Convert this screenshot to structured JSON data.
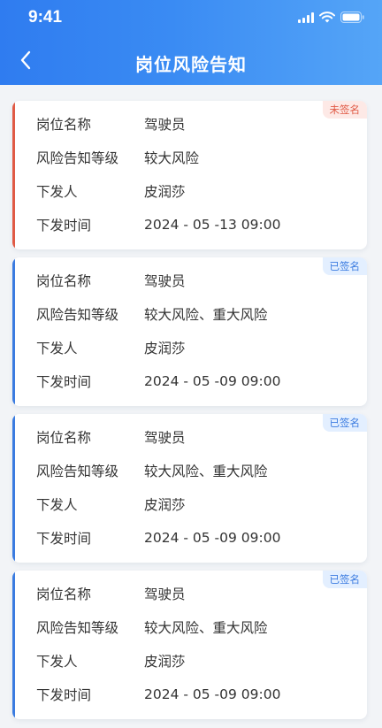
{
  "status_bar": {
    "time": "9:41"
  },
  "header": {
    "title": "岗位风险告知"
  },
  "labels": {
    "position_name": "岗位名称",
    "risk_level": "风险告知等级",
    "issuer": "下发人",
    "issue_time": "下发时间"
  },
  "cards": [
    {
      "badge": "未签名",
      "status": "unsigned",
      "position_name": "驾驶员",
      "risk_level": "较大风险",
      "issuer": "皮润莎",
      "issue_time": "2024 - 05 -13 09:00"
    },
    {
      "badge": "已签名",
      "status": "signed",
      "position_name": "驾驶员",
      "risk_level": "较大风险、重大风险",
      "issuer": "皮润莎",
      "issue_time": "2024 - 05 -09 09:00"
    },
    {
      "badge": "已签名",
      "status": "signed",
      "position_name": "驾驶员",
      "risk_level": "较大风险、重大风险",
      "issuer": "皮润莎",
      "issue_time": "2024 - 05 -09 09:00"
    },
    {
      "badge": "已签名",
      "status": "signed",
      "position_name": "驾驶员",
      "risk_level": "较大风险、重大风险",
      "issuer": "皮润莎",
      "issue_time": "2024 - 05 -09 09:00"
    }
  ],
  "colors": {
    "header_start": "#2f7cf0",
    "header_end": "#55a5f7",
    "unsigned_accent": "#e05a45",
    "unsigned_badge_bg": "#fde9e6",
    "unsigned_badge_text": "#e05a45",
    "signed_accent": "#3a7be0",
    "signed_badge_bg": "#e3efff",
    "signed_badge_text": "#3a7be0"
  }
}
